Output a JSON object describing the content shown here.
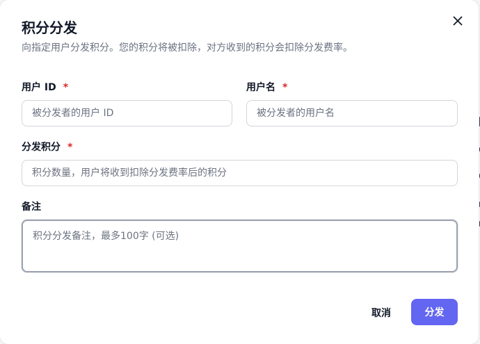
{
  "dialog": {
    "title": "积分分发",
    "subtitle": "向指定用户分发积分。您的积分将被扣除，对方收到的积分会扣除分发费率。"
  },
  "form": {
    "user_id": {
      "label": "用户 ID",
      "required_mark": "*",
      "placeholder": "被分发者的用户 ID",
      "value": ""
    },
    "username": {
      "label": "用户名",
      "required_mark": "*",
      "placeholder": "被分发者的用户名",
      "value": ""
    },
    "amount": {
      "label": "分发积分",
      "required_mark": "*",
      "placeholder": "积分数量，用户将收到扣除分发费率后的积分",
      "value": ""
    },
    "note": {
      "label": "备注",
      "placeholder": "积分分发备注，最多100字 (可选)",
      "value": ""
    }
  },
  "actions": {
    "cancel_label": "取消",
    "submit_label": "分发"
  },
  "colors": {
    "accent": "#6366f1",
    "required": "#dc2626",
    "title_text": "#111827",
    "muted_text": "#6b7280",
    "border": "#d1d5db"
  },
  "icons": {
    "close": "close-icon"
  }
}
